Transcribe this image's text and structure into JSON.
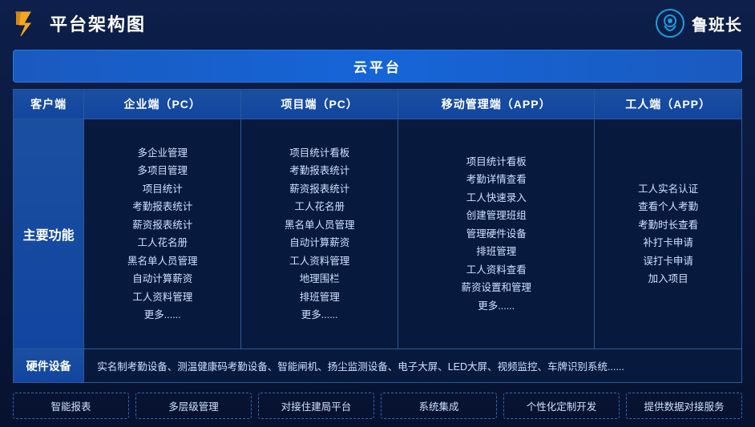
{
  "header": {
    "title": "平台架构图",
    "brand_name": "鲁班长"
  },
  "cloud_banner": "云平台",
  "columns": {
    "client": "客户端",
    "enterprise_pc": "企业端（PC）",
    "project_pc": "项目端（PC）",
    "mobile_app": "移动管理端（APP）",
    "worker_app": "工人端（APP）"
  },
  "row_labels": {
    "main_features": "主要功能",
    "hardware": "硬件设备"
  },
  "enterprise_features": [
    "多企业管理",
    "多项目管理",
    "项目统计",
    "考勤报表统计",
    "薪资报表统计",
    "工人花名册",
    "黑名单人员管理",
    "自动计算薪资",
    "工人资料管理",
    "更多......"
  ],
  "project_features": [
    "项目统计看板",
    "考勤报表统计",
    "薪资报表统计",
    "工人花名册",
    "黑名单人员管理",
    "自动计算薪资",
    "工人资料管理",
    "地理围栏",
    "排班管理",
    "更多......"
  ],
  "mobile_features": [
    "项目统计看板",
    "考勤详情查看",
    "工人快速录入",
    "创建管理班组",
    "管理硬件设备",
    "排班管理",
    "工人资料查看",
    "薪资设置和管理",
    "更多......"
  ],
  "worker_features": [
    "工人实名认证",
    "查看个人考勤",
    "考勤时长查看",
    "补打卡申请",
    "误打卡申请",
    "加入项目"
  ],
  "hardware_content": "实名制考勤设备、测温健康码考勤设备、智能闸机、扬尘监测设备、电子大屏、LED大屏、视频监控、车牌识别系统......",
  "bottom_items": [
    "智能报表",
    "多层级管理",
    "对接住建局平台",
    "系统集成",
    "个性化定制开发",
    "提供数据对接服务"
  ]
}
